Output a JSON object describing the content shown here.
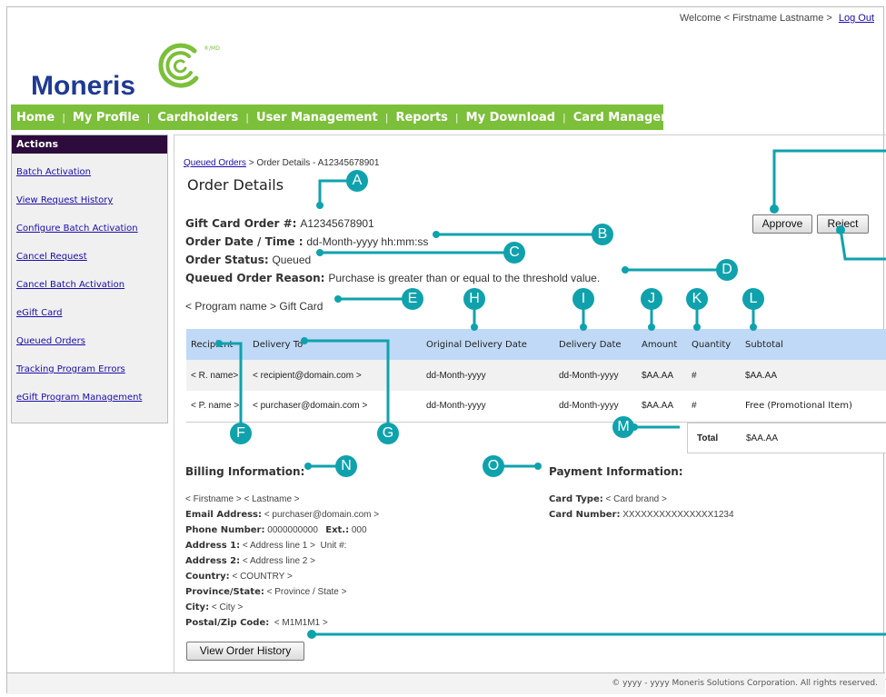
{
  "header": {
    "welcome": "Welcome < Firstname Lastname >",
    "logout": "Log Out",
    "logo": "Moneris",
    "logo_mark": "®/MD"
  },
  "nav": [
    "Home",
    "My Profile",
    "Cardholders",
    "User Management",
    "Reports",
    "My Download",
    "Card Management"
  ],
  "sidebar": {
    "title": "Actions",
    "items": [
      "Batch Activation",
      "View Request History",
      "Configure Batch Activation",
      "Cancel Request",
      "Cancel Batch Activation",
      "eGift Card",
      "Queued Orders",
      "Tracking Program Errors",
      "eGift Program Management"
    ]
  },
  "breadcrumb": {
    "link": "Queued Orders",
    "rest": " > Order Details - A12345678901"
  },
  "page": {
    "title": "Order Details",
    "order_num_label": "Gift Card Order #:",
    "order_num": "A12345678901",
    "datetime_label": "Order Date / Time :",
    "datetime": "dd-Month-yyyy hh:mm:ss",
    "status_label": "Order Status:",
    "status": "Queued",
    "reason_label": "Queued Order Reason:",
    "reason": "Purchase is greater than or equal to the threshold value.",
    "program": "< Program name > Gift Card"
  },
  "buttons": {
    "approve": "Approve",
    "reject": "Reject",
    "history": "View Order History"
  },
  "table": {
    "headers": [
      "Recipient",
      "Delivery To",
      "Original Delivery Date",
      "Delivery Date",
      "Amount",
      "Quantity",
      "Subtotal"
    ],
    "rows": [
      [
        "< R. name>",
        "< recipient@domain.com >",
        "dd-Month-yyyy",
        "dd-Month-yyyy",
        "$AA.AA",
        "#",
        "$AA.AA"
      ],
      [
        "< P. name >",
        "< purchaser@domain.com >",
        "dd-Month-yyyy",
        "dd-Month-yyyy",
        "$AA.AA",
        "#",
        "Free (Promotional Item)"
      ]
    ],
    "total_label": "Total",
    "total_value": "$AA.AA"
  },
  "billing": {
    "title": "Billing Information:",
    "name": "< Firstname > < Lastname >",
    "email_label": "Email Address:",
    "email": "< purchaser@domain.com >",
    "phone_label": "Phone Number:",
    "phone": "0000000000",
    "ext_label": "Ext.:",
    "ext": "000",
    "addr1_label": "Address 1:",
    "addr1": "< Address line 1 >",
    "unit_label": "Unit #:",
    "addr2_label": "Address 2:",
    "addr2": "< Address line 2 >",
    "country_label": "Country:",
    "country": "< COUNTRY >",
    "province_label": "Province/State:",
    "province": "< Province / State >",
    "city_label": "City:",
    "city": "< City >",
    "postal_label": "Postal/Zip Code:",
    "postal": "< M1M1M1 >"
  },
  "payment": {
    "title": "Payment Information:",
    "card_type_label": "Card Type:",
    "card_type": "< Card brand >",
    "card_number_label": "Card Number:",
    "card_number": "XXXXXXXXXXXXXXX1234"
  },
  "footer": "© yyyy - yyyy Moneris Solutions Corporation. All rights reserved.",
  "callouts": [
    "A",
    "B",
    "C",
    "D",
    "E",
    "F",
    "G",
    "H",
    "I",
    "J",
    "K",
    "L",
    "M",
    "N",
    "O"
  ],
  "colors": {
    "accent": "#0fa2ad",
    "nav": "#7cbf3a",
    "sidebar_header": "#2d0b3d",
    "table_header": "#bfd9f6",
    "brand": "#1f3a93"
  }
}
